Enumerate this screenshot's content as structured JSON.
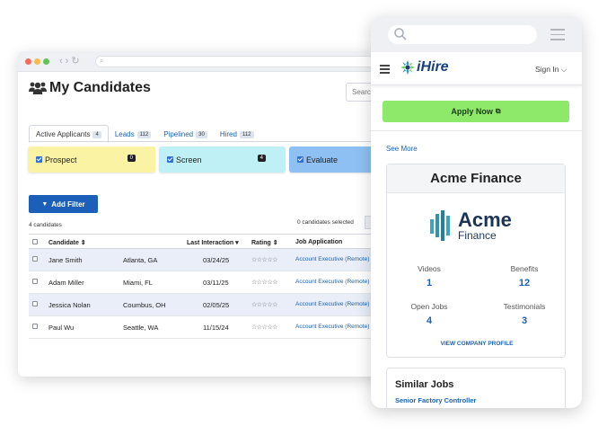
{
  "desktop": {
    "page_title": "My Candidates",
    "search_placeholder": "Search",
    "tabs": [
      {
        "label": "Active Applicants",
        "count": "4"
      },
      {
        "label": "Leads",
        "count": "112"
      },
      {
        "label": "Pipelined",
        "count": "30"
      },
      {
        "label": "Hired",
        "count": "112"
      }
    ],
    "stages": [
      {
        "label": "Prospect",
        "count": "0",
        "color": "#fbf3a4"
      },
      {
        "label": "Screen",
        "count": "4",
        "color": "#bff0f6"
      },
      {
        "label": "Evaluate",
        "count": "",
        "color": "#8ec0f4"
      }
    ],
    "add_filter_label": "Add Filter",
    "candidate_count": "4 candidates",
    "selected_count": "0 candidates selected",
    "table": {
      "headers": {
        "candidate": "Candidate ⇕",
        "last_interaction": "Last Interaction ▾",
        "rating": "Rating ⇕",
        "job_application": "Job Application"
      },
      "rows": [
        {
          "name": "Jane Smith",
          "location": "Atlanta, GA",
          "date": "03/24/25",
          "rating": "☆☆☆☆☆",
          "job": "Account Executive (Remote)"
        },
        {
          "name": "Adam Miller",
          "location": "Miami, FL",
          "date": "03/11/25",
          "rating": "☆☆☆☆☆",
          "job": "Account Executive (Remote)"
        },
        {
          "name": "Jessica Nolan",
          "location": "Coumbus, OH",
          "date": "02/05/25",
          "rating": "☆☆☆☆☆",
          "job": "Account Executive (Remote)"
        },
        {
          "name": "Paul Wu",
          "location": "Seattle, WA",
          "date": "11/15/24",
          "rating": "☆☆☆☆☆",
          "job": "Account Executive (Remote)"
        }
      ]
    }
  },
  "mobile": {
    "brand": "iHire",
    "sign_in": "Sign In ⌵",
    "apply_label": "Apply Now",
    "see_more": "See More",
    "company_name": "Acme Finance",
    "logo_big": "Acme",
    "logo_small": "Finance",
    "stats": [
      {
        "label": "Videos",
        "value": "1"
      },
      {
        "label": "Benefits",
        "value": "12"
      },
      {
        "label": "Open Jobs",
        "value": "4"
      },
      {
        "label": "Testimonials",
        "value": "3"
      }
    ],
    "view_profile": "VIEW COMPANY PROFILE",
    "similar_title": "Similar Jobs",
    "similar_job": "Senior Factory Controller"
  },
  "colors": {
    "accent_blue": "#1b5fb8",
    "apply_green": "#8ee86a",
    "brand_navy": "#17417c"
  }
}
